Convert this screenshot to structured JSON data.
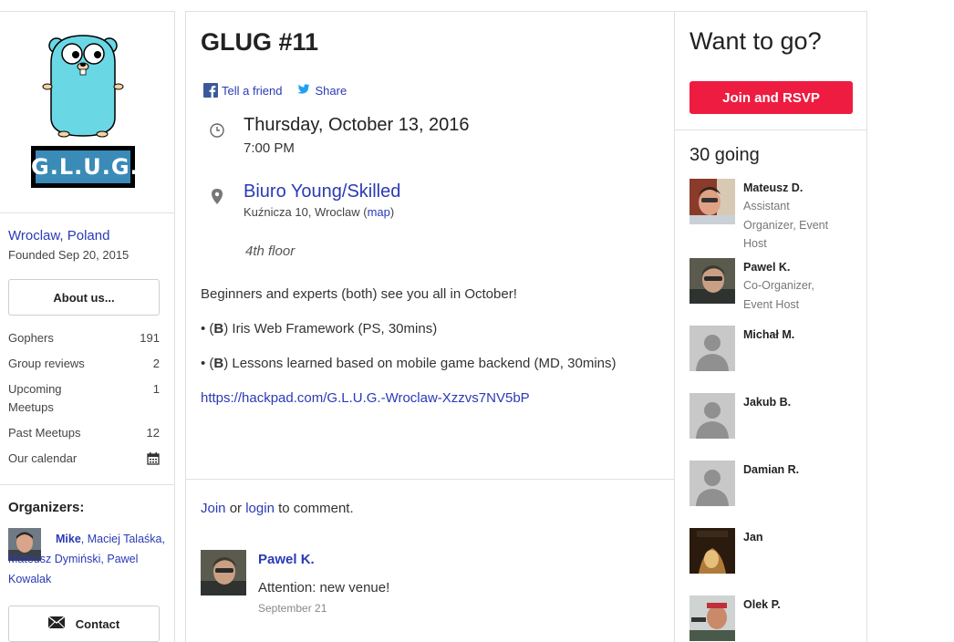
{
  "sidebar": {
    "logo_text": "G.L.U.G.",
    "location": "Wroclaw, Poland",
    "founded": "Founded Sep 20, 2015",
    "about_button": "About us...",
    "stats": [
      {
        "label": "Gophers",
        "value": "191"
      },
      {
        "label": "Group reviews",
        "value": "2"
      },
      {
        "label": "Upcoming Meetups",
        "value": "1"
      },
      {
        "label": "Past Meetups",
        "value": "12"
      },
      {
        "label": "Our calendar",
        "icon": "calendar-icon"
      }
    ],
    "organizers_title": "Organizers:",
    "organizers": {
      "first": "Mike",
      "rest": ", Maciej Talaśka, Mateusz Dymiński, Pawel Kowalak"
    },
    "contact_button": "Contact"
  },
  "event": {
    "title": "GLUG #11",
    "tell_friend": "Tell a friend",
    "share": "Share",
    "date": "Thursday, October 13, 2016",
    "time": "7:00 PM",
    "venue": "Biuro Young/Skilled",
    "address": "Kuźnicza 10, Wroclaw (",
    "map_link": "map",
    "address_end": ")",
    "floor_note": "4th floor",
    "description": {
      "intro": "Beginners and experts (both) see you all in October!",
      "item1_prefix": "• (",
      "item1_bold": "B",
      "item1_text": ") Iris Web Framework (PS, 30mins)",
      "item2_prefix": "• (",
      "item2_bold": "B",
      "item2_text": ") Lessons learned based on mobile game backend (MD, 30mins)",
      "link": "https://hackpad.com/G.L.U.G.-Wroclaw-Xzzvs7NV5bP"
    }
  },
  "comments": {
    "join": "Join",
    "or": " or ",
    "login": "login",
    "suffix": " to comment.",
    "items": [
      {
        "author": "Pawel K.",
        "text": "Attention: new venue!",
        "date": "September 21"
      }
    ]
  },
  "rsvp": {
    "heading": "Want to go?",
    "button": "Join and RSVP",
    "going": "30 going",
    "attendees": [
      {
        "name": "Mateusz D.",
        "role": "Assistant Organizer, Event Host"
      },
      {
        "name": "Pawel K.",
        "role": "Co-Organizer, Event Host"
      },
      {
        "name": "Michał M.",
        "role": ""
      },
      {
        "name": "Jakub B.",
        "role": ""
      },
      {
        "name": "Damian R.",
        "role": ""
      },
      {
        "name": "Jan",
        "role": ""
      },
      {
        "name": "Olek P.",
        "role": ""
      }
    ]
  },
  "colors": {
    "link": "#2a3ab6",
    "rsvp_button": "#ed1c40",
    "facebook": "#3b5998",
    "twitter": "#1da1f2"
  }
}
